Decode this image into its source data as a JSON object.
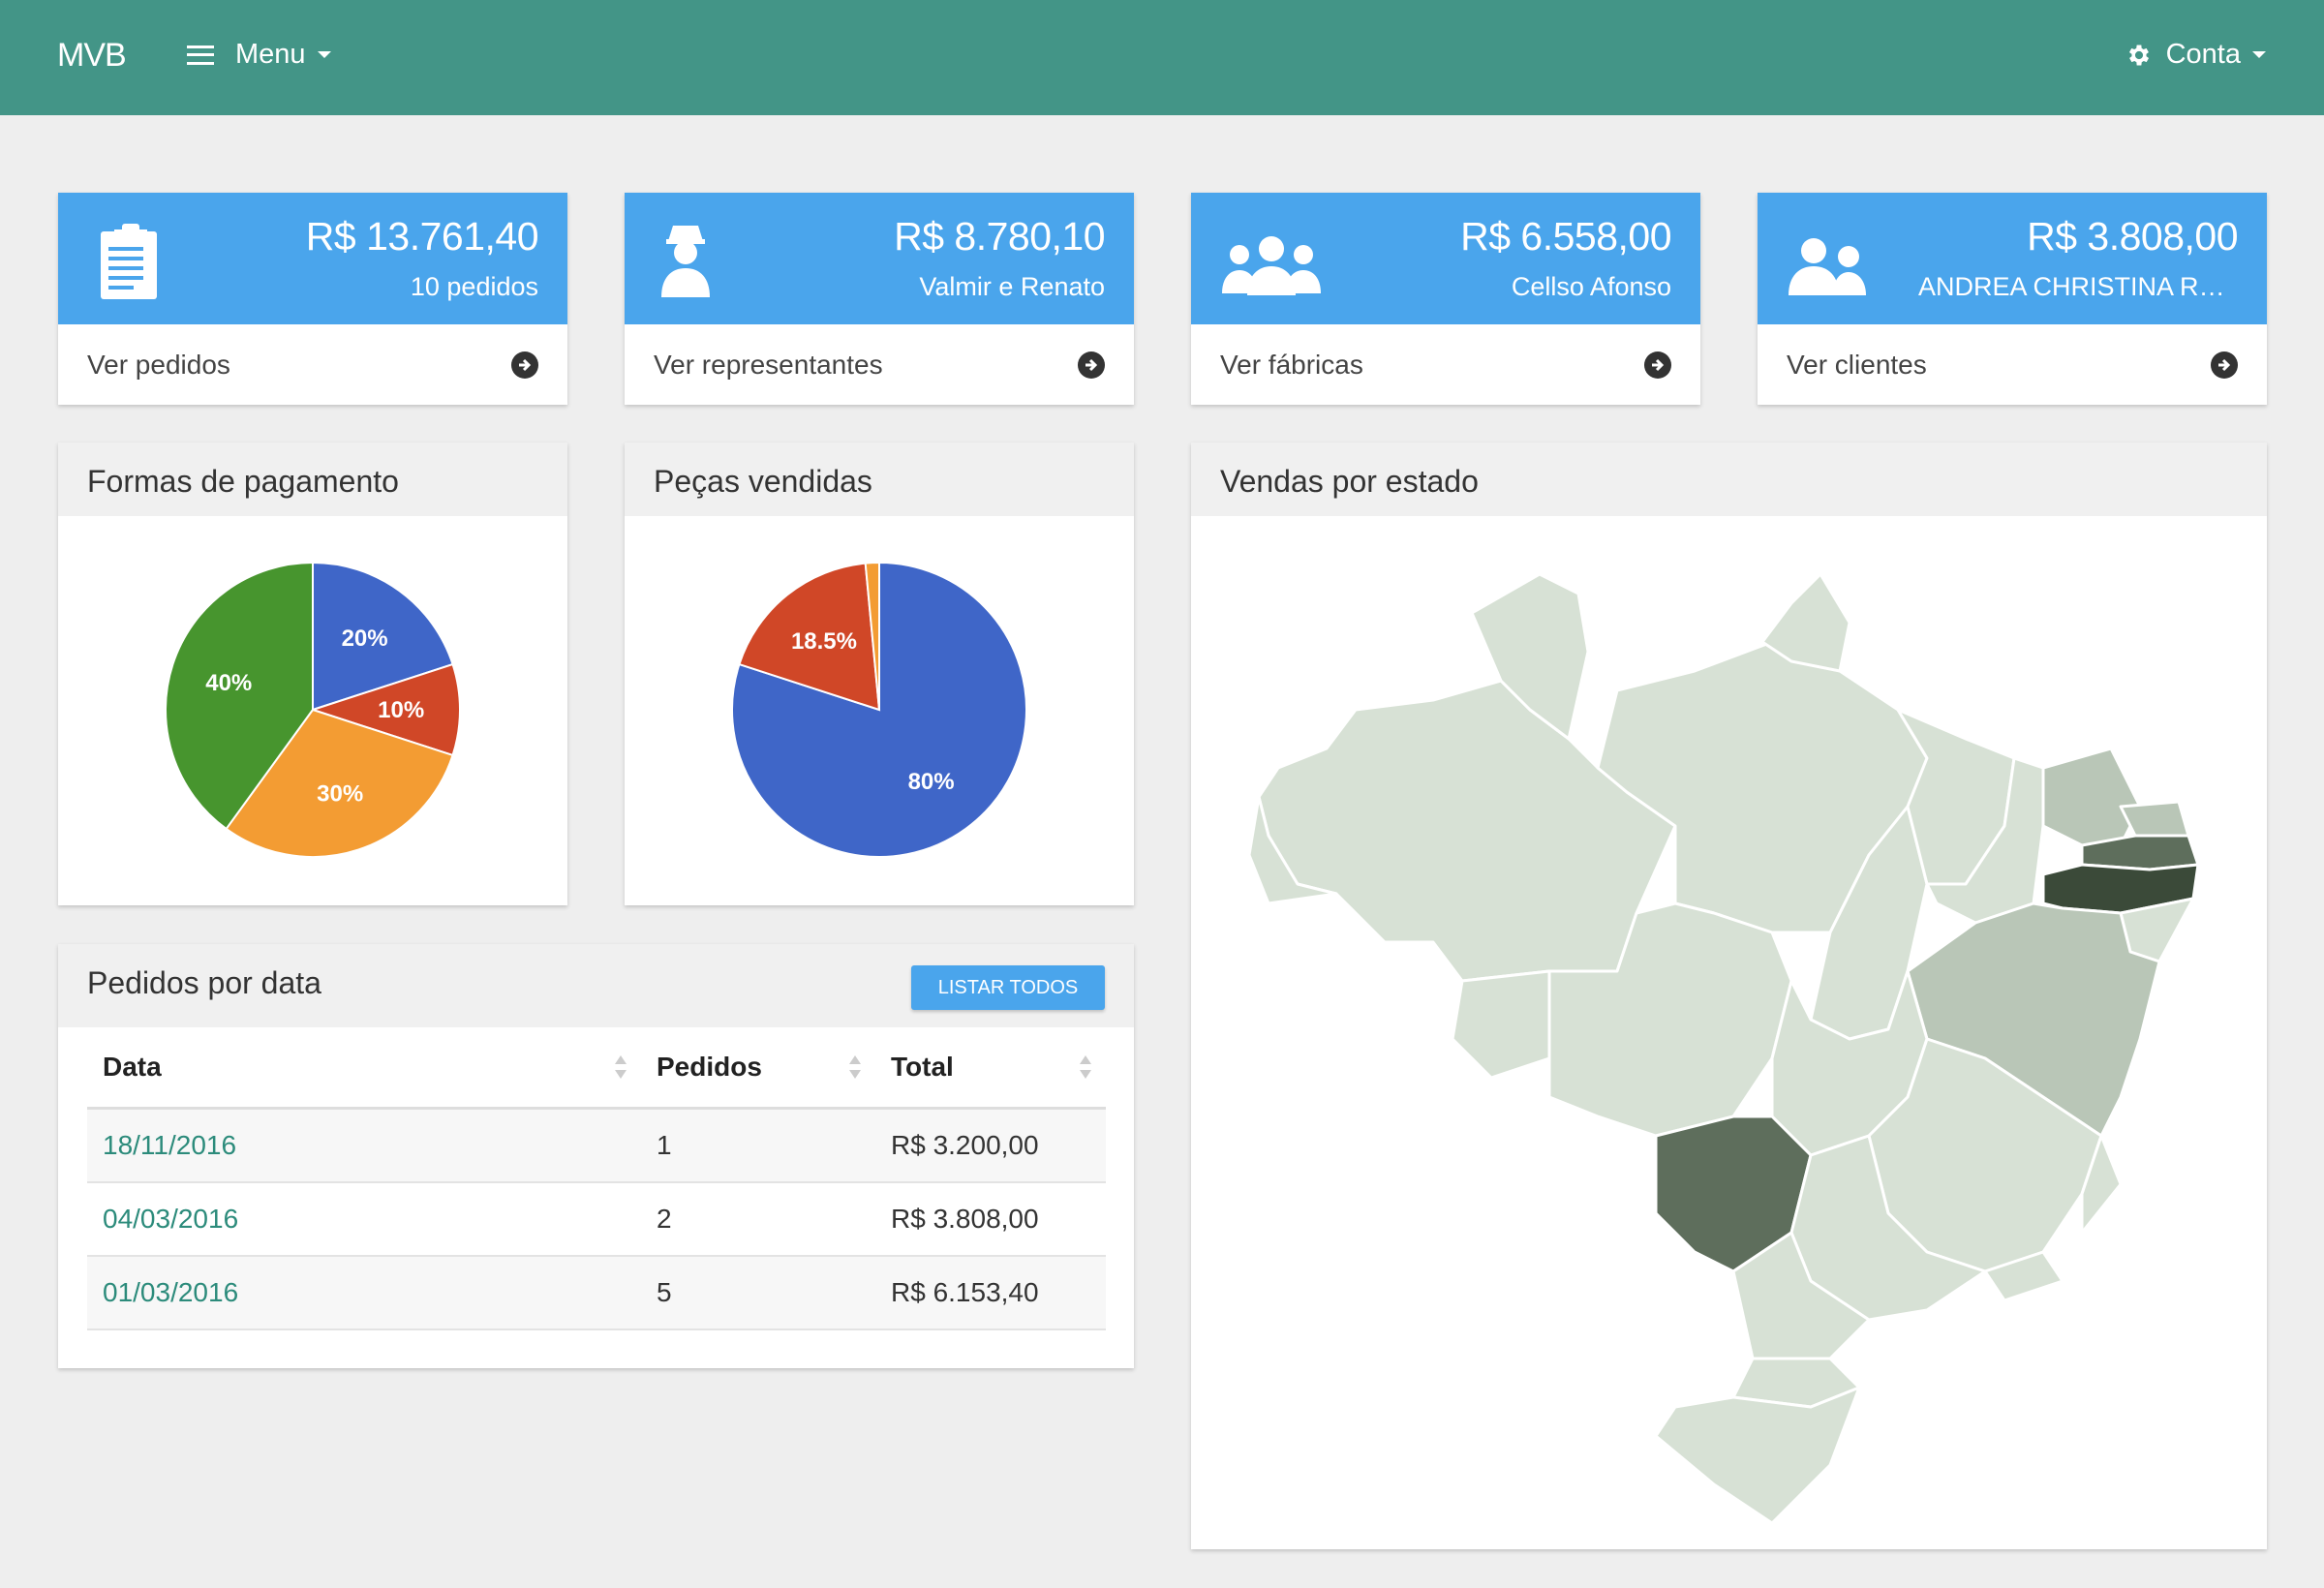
{
  "navbar": {
    "brand": "MVB",
    "menu_label": "Menu",
    "account_label": "Conta",
    "color": "#439587"
  },
  "stats": [
    {
      "icon": "clipboard-icon",
      "amount": "R$ 13.761,40",
      "sub": "10 pedidos",
      "link": "Ver pedidos"
    },
    {
      "icon": "user-icon",
      "amount": "R$ 8.780,10",
      "sub": "Valmir e Renato",
      "link": "Ver representantes"
    },
    {
      "icon": "users-group-icon",
      "amount": "R$ 6.558,00",
      "sub": "Cellso Afonso",
      "link": "Ver fábricas"
    },
    {
      "icon": "users-pair-icon",
      "amount": "R$ 3.808,00",
      "sub": "ANDREA CHRISTINA RE...",
      "link": "Ver clientes"
    }
  ],
  "payments_panel": {
    "title": "Formas de pagamento"
  },
  "parts_panel": {
    "title": "Peças vendidas"
  },
  "map_panel": {
    "title": "Vendas por estado",
    "highlight_colors": [
      "#d7e1d5",
      "#b9c6b7",
      "#5e6e5c",
      "#3b4a39"
    ]
  },
  "orders_panel": {
    "title": "Pedidos por data",
    "button_label": "Listar todos",
    "columns": [
      "Data",
      "Pedidos",
      "Total"
    ],
    "rows": [
      {
        "date": "18/11/2016",
        "count": "1",
        "total": "R$ 3.200,00"
      },
      {
        "date": "04/03/2016",
        "count": "2",
        "total": "R$ 3.808,00"
      },
      {
        "date": "01/03/2016",
        "count": "5",
        "total": "R$ 6.153,40"
      }
    ]
  },
  "chart_data": [
    {
      "type": "pie",
      "title": "Formas de pagamento",
      "slices": [
        {
          "label": "20%",
          "value": 20,
          "color": "#3f66c8"
        },
        {
          "label": "10%",
          "value": 10,
          "color": "#d04727"
        },
        {
          "label": "30%",
          "value": 30,
          "color": "#f39c33"
        },
        {
          "label": "40%",
          "value": 40,
          "color": "#47952e"
        }
      ]
    },
    {
      "type": "pie",
      "title": "Peças vendidas",
      "slices": [
        {
          "label": "80%",
          "value": 80,
          "color": "#3f66c8"
        },
        {
          "label": "18.5%",
          "value": 18.5,
          "color": "#d04727"
        },
        {
          "label": "",
          "value": 1.5,
          "color": "#f39c33"
        }
      ]
    }
  ]
}
